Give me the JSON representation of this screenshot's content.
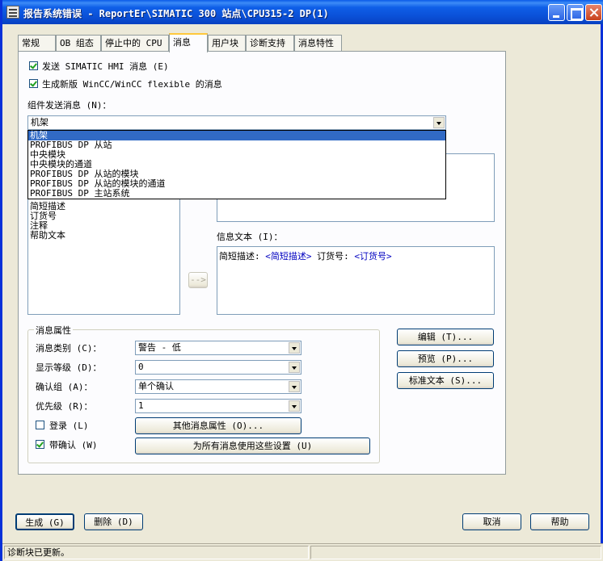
{
  "window": {
    "title": "报告系统错误 - ReportEr\\SIMATIC 300 站点\\CPU315-2 DP(1)"
  },
  "tabs": [
    "常规",
    "OB 组态",
    "停止中的 CPU",
    "消息",
    "用户块",
    "诊断支持",
    "消息特性"
  ],
  "active_tab": "消息",
  "messages_tab": {
    "send_hmi_label": "发送 SIMATIC HMI 消息 (E)",
    "send_hmi_checked": true,
    "new_wincc_label": "生成新版 WinCC/WinCC flexible 的消息",
    "new_wincc_checked": true,
    "component_label": "组件发送消息 (N)：",
    "component_value": "机架",
    "component_options": [
      "机架",
      "PROFIBUS DP 从站",
      "中央模块",
      "中央模块的通道",
      "PROFIBUS DP 从站的模块",
      "PROFIBUS DP 从站的模块的通道",
      "PROFIBUS DP 主站系统"
    ],
    "field_list": [
      "简短描述",
      "订货号",
      "注释",
      "帮助文本"
    ],
    "info_text_label": "信息文本 (I)：",
    "info_text": {
      "part1": "简短描述: ",
      "tag1": "<简短描述>",
      "part2": " 订货号: ",
      "tag2": "<订货号>"
    },
    "insert_button": "-->"
  },
  "properties": {
    "group_title": "消息属性",
    "msg_class_label": "消息类别 (C)：",
    "msg_class_value": "警告 - 低",
    "display_level_label": "显示等级 (D)：",
    "display_level_value": "0",
    "ack_group_label": "确认组 (A)：",
    "ack_group_value": "单个确认",
    "priority_label": "优先级 (R)：",
    "priority_value": "1",
    "log_label": "登录 (L)",
    "log_checked": false,
    "with_ack_label": "带确认 (W)",
    "with_ack_checked": true,
    "other_props_button": "其他消息属性 (O)...",
    "apply_all_button": "为所有消息使用这些设置 (U)"
  },
  "side_buttons": {
    "edit": "编辑 (T)...",
    "preview": "预览 (P)...",
    "standard_text": "标准文本 (S)..."
  },
  "footer": {
    "generate": "生成 (G)",
    "delete": "删除 (D)",
    "cancel": "取消",
    "help": "帮助"
  },
  "status": {
    "text": "诊断块已更新。"
  }
}
